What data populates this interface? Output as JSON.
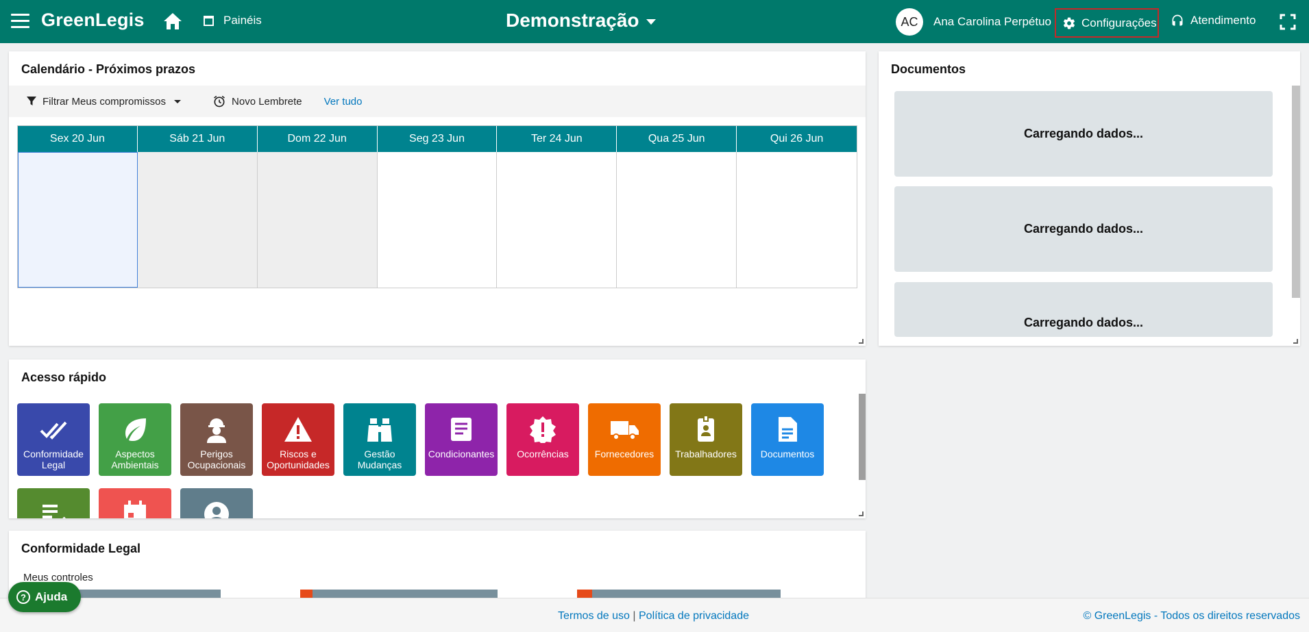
{
  "header": {
    "brand": "GreenLegis",
    "panels_label": "Painéis",
    "workspace": "Demonstração",
    "user_initials": "AC",
    "user_name": "Ana Carolina Perpétuo",
    "config_label": "Configurações",
    "support_label": "Atendimento"
  },
  "calendar": {
    "title": "Calendário - Próximos prazos",
    "filter_label": "Filtrar Meus compromissos",
    "reminder_label": "Novo Lembrete",
    "see_all_label": "Ver tudo",
    "days": [
      "Sex 20 Jun",
      "Sáb 21 Jun",
      "Dom 22 Jun",
      "Seg 23 Jun",
      "Ter 24 Jun",
      "Qua 25 Jun",
      "Qui 26 Jun"
    ]
  },
  "documents": {
    "title": "Documentos",
    "loading_items": [
      "Carregando dados...",
      "Carregando dados...",
      "Carregando dados..."
    ]
  },
  "quick_access": {
    "title": "Acesso rápido",
    "tiles": [
      {
        "label": "Conformidade Legal",
        "icon": "double-check-icon",
        "color": "#3949ab"
      },
      {
        "label": "Aspectos Ambientais",
        "icon": "leaf-icon",
        "color": "#43a047"
      },
      {
        "label": "Perigos Ocupacionais",
        "icon": "worker-icon",
        "color": "#795548"
      },
      {
        "label": "Riscos e Oportunidades",
        "icon": "warning-icon",
        "color": "#c62828"
      },
      {
        "label": "Gestão Mudanças",
        "icon": "binoculars-icon",
        "color": "#00838f"
      },
      {
        "label": "Condicionantes",
        "icon": "document-lines-icon",
        "color": "#8e24aa"
      },
      {
        "label": "Ocorrências",
        "icon": "alert-badge-icon",
        "color": "#d81b60"
      },
      {
        "label": "Fornecedores",
        "icon": "truck-icon",
        "color": "#ef6c00"
      },
      {
        "label": "Trabalhadores",
        "icon": "id-badge-icon",
        "color": "#827717"
      },
      {
        "label": "Documentos",
        "icon": "file-icon",
        "color": "#1e88e5"
      },
      {
        "label": "",
        "icon": "checklist-icon",
        "color": "#558b2f"
      },
      {
        "label": "",
        "icon": "calendar-icon",
        "color": "#ef5350"
      },
      {
        "label": "",
        "icon": "account-icon",
        "color": "#607d8b"
      }
    ]
  },
  "compliance": {
    "title": "Conformidade Legal",
    "subtitle": "Meus controles"
  },
  "footer": {
    "terms": "Termos de uso",
    "separator": "|",
    "privacy": "Política de privacidade",
    "copyright": "© GreenLegis - Todos os direitos reservados"
  },
  "help_label": "Ajuda"
}
